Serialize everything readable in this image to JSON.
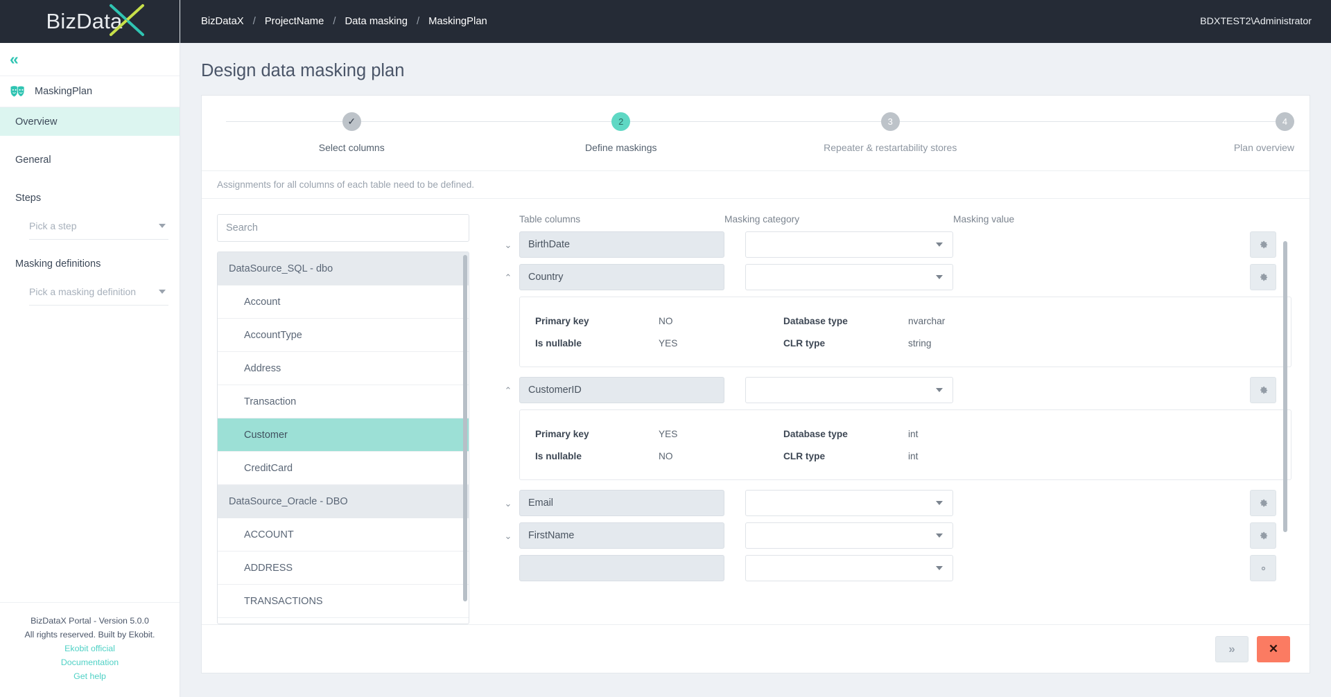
{
  "brand": {
    "logo_text": "BizData",
    "logo_accent_letter": "X",
    "accent_color": "#2fc4b2",
    "accent_secondary": "#c8e04a",
    "danger_color": "#fb7b62"
  },
  "sidebar": {
    "collapse_icon": "chevron-double-left-icon",
    "plan": {
      "icon": "masks-icon",
      "label": "MaskingPlan"
    },
    "items": [
      {
        "label": "Overview",
        "active": true
      },
      {
        "label": "General",
        "active": false
      },
      {
        "label": "Steps",
        "active": false
      }
    ],
    "step_picker": {
      "placeholder": "Pick a step",
      "icon": "chevron-down-icon"
    },
    "masking_definitions_label": "Masking definitions",
    "masking_picker": {
      "placeholder": "Pick a masking definition",
      "icon": "chevron-down-icon"
    },
    "footer": {
      "version": "BizDataX Portal - Version 5.0.0",
      "rights": "All rights reserved. Built by Ekobit.",
      "links": [
        "Ekobit official",
        "Documentation",
        "Get help"
      ]
    }
  },
  "topbar": {
    "breadcrumbs": [
      "BizDataX",
      "ProjectName",
      "Data masking",
      "MaskingPlan"
    ],
    "separator": "/",
    "user": "BDXTEST2\\Administrator"
  },
  "page": {
    "title": "Design data masking plan",
    "hint": "Assignments for all columns of each table need to be defined."
  },
  "stepper": {
    "steps": [
      {
        "num": "1",
        "glyph": "✓",
        "label": "Select columns",
        "state": "done"
      },
      {
        "num": "2",
        "glyph": "2",
        "label": "Define maskings",
        "state": "active"
      },
      {
        "num": "3",
        "glyph": "3",
        "label": "Repeater & restartability stores",
        "state": "inactive"
      },
      {
        "num": "4",
        "glyph": "4",
        "label": "Plan overview",
        "state": "inactive"
      }
    ]
  },
  "left_pane": {
    "search": {
      "placeholder": "Search",
      "value": ""
    },
    "groups": [
      {
        "name": "DataSource_SQL - dbo",
        "tables": [
          {
            "name": "Account",
            "selected": false
          },
          {
            "name": "AccountType",
            "selected": false
          },
          {
            "name": "Address",
            "selected": false
          },
          {
            "name": "Transaction",
            "selected": false
          },
          {
            "name": "Customer",
            "selected": true
          },
          {
            "name": "CreditCard",
            "selected": false
          }
        ]
      },
      {
        "name": "DataSource_Oracle - DBO",
        "tables": [
          {
            "name": "ACCOUNT",
            "selected": false
          },
          {
            "name": "ADDRESS",
            "selected": false
          },
          {
            "name": "TRANSACTIONS",
            "selected": false
          }
        ]
      }
    ]
  },
  "right_pane": {
    "headers": {
      "column": "Table columns",
      "category": "Masking category",
      "value": "Masking value"
    },
    "detail_labels": {
      "primary_key": "Primary key",
      "is_nullable": "Is nullable",
      "database_type": "Database type",
      "clr_type": "CLR type"
    },
    "settings_icon": "gear-icon",
    "rows": [
      {
        "column": "BirthDate",
        "category_value": "",
        "masking_value": "",
        "expanded": false,
        "twisty": "⌄"
      },
      {
        "column": "Country",
        "category_value": "",
        "masking_value": "",
        "expanded": true,
        "twisty": "⌃",
        "detail": {
          "primary_key": "NO",
          "is_nullable": "YES",
          "database_type": "nvarchar",
          "clr_type": "string"
        }
      },
      {
        "column": "CustomerID",
        "category_value": "",
        "masking_value": "",
        "expanded": true,
        "twisty": "⌃",
        "detail": {
          "primary_key": "YES",
          "is_nullable": "NO",
          "database_type": "int",
          "clr_type": "int"
        }
      },
      {
        "column": "Email",
        "category_value": "",
        "masking_value": "",
        "expanded": false,
        "twisty": "⌄"
      },
      {
        "column": "FirstName",
        "category_value": "",
        "masking_value": "",
        "expanded": false,
        "twisty": "⌄"
      }
    ]
  },
  "footer_actions": {
    "next_label": "»",
    "close_label": "✕"
  }
}
